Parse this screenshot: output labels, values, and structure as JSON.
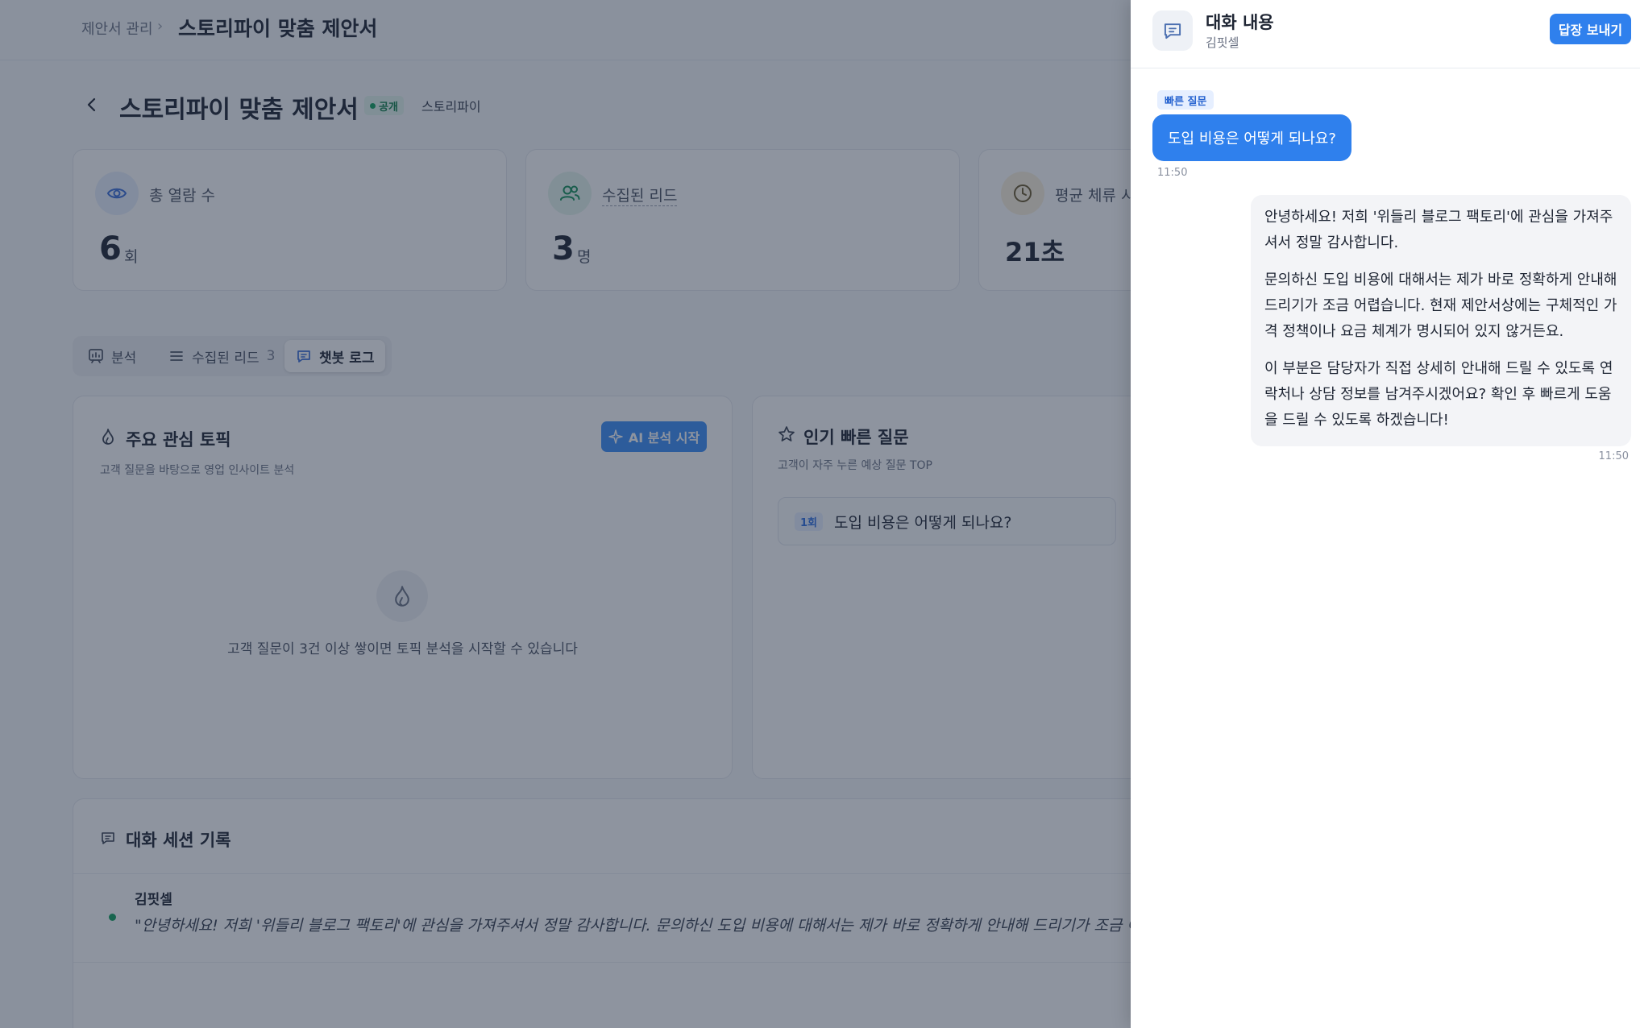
{
  "breadcrumb": {
    "parent": "제안서 관리",
    "separator": "›",
    "current": "스토리파이 맞춤 제안서"
  },
  "header": {
    "title": "스토리파이 맞춤 제안서",
    "status": "공개",
    "company": "스토리파이"
  },
  "stats": [
    {
      "label": "총 열람 수",
      "value": "6",
      "unit": "회",
      "icon": "eye-icon",
      "color": "#3b6fd8"
    },
    {
      "label": "수집된 리드",
      "value": "3",
      "unit": "명",
      "icon": "users-icon",
      "color": "#16915a"
    },
    {
      "label": "평균 체류 시간",
      "value": "21초",
      "unit": "",
      "icon": "clock-icon",
      "color": "#b07a16"
    }
  ],
  "tabs": [
    {
      "label": "분석",
      "icon": "chart-icon",
      "count": ""
    },
    {
      "label": "수집된 리드",
      "icon": "list-icon",
      "count": "3"
    },
    {
      "label": "챗봇 로그",
      "icon": "chat-icon",
      "count": "",
      "active": true
    }
  ],
  "topics_panel": {
    "title": "주요 관심 토픽",
    "subtitle": "고객 질문을 바탕으로 영업 인사이트 분석",
    "button": "AI 분석 시작",
    "empty_text": "고객 질문이 3건 이상 쌓이면 토픽 분석을 시작할 수 있습니다"
  },
  "questions_panel": {
    "title": "인기 빠른 질문",
    "subtitle": "고객이 자주 누른 예상 질문 TOP",
    "items": [
      {
        "count": "1회",
        "text": "도입 비용은 어떻게 되나요?"
      }
    ]
  },
  "sessions_panel": {
    "title": "대화 세션 기록",
    "items": [
      {
        "name": "김핏셀",
        "preview": "\"안녕하세요! 저희 '위들리 블로그 팩토리'에 관심을 가져주셔서 정말 감사합니다. 문의하신 도입 비용에 대해서는 제가 바로 정확하게 안내해 드리기가 조금 어렵습니다. 현"
      }
    ]
  },
  "drawer": {
    "title": "대화 내용",
    "subtitle": "김핏셀",
    "reply_button": "답장 보내기",
    "messages": {
      "user": {
        "tag": "빠른 질문",
        "text": "도입 비용은 어떻게 되나요?",
        "time": "11:50"
      },
      "bot": {
        "paragraphs": [
          "안녕하세요! 저희 '위들리 블로그 팩토리'에 관심을 가져주셔서 정말 감사합니다.",
          "문의하신 도입 비용에 대해서는 제가 바로 정확하게 안내해 드리기가 조금 어렵습니다. 현재 제안서상에는 구체적인 가격 정책이나 요금 체계가 명시되어 있지 않거든요.",
          "이 부분은 담당자가 직접 상세히 안내해 드릴 수 있도록 연락처나 상담 정보를 남겨주시겠어요? 확인 후 빠르게 도움을 드릴 수 있도록 하겠습니다!"
        ],
        "time": "11:50"
      }
    }
  }
}
